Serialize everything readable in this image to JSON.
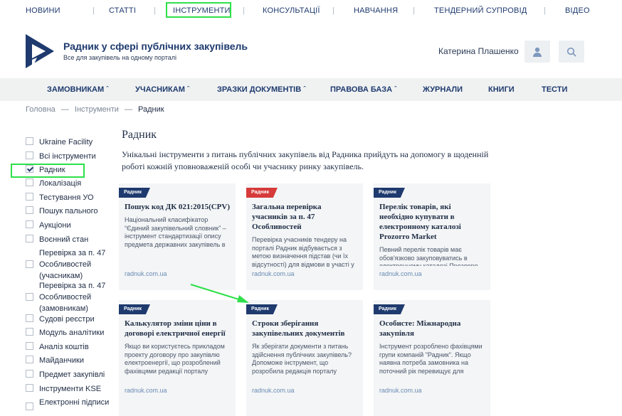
{
  "topnav": [
    "НОВИНИ",
    "СТАТТІ",
    "ІНСТРУМЕНТИ",
    "КОНСУЛЬТАЦІЇ",
    "НАВЧАННЯ",
    "ТЕНДЕРНИЙ СУПРОВІД",
    "ВІДЕО"
  ],
  "brand": {
    "title": "Радник у сфері публічних закупівель",
    "tagline": "Все для закупівель на одному порталі"
  },
  "user": {
    "name": "Катерина Плашенко"
  },
  "icons": {
    "user": "user-icon",
    "search": "search-icon",
    "chevron": "chevron-up-icon"
  },
  "mainnav": [
    "ЗАМОВНИКАМ",
    "УЧАСНИКАМ",
    "ЗРАЗКИ ДОКУМЕНТІВ",
    "ПРАВОВА БАЗА",
    "ЖУРНАЛИ",
    "КНИГИ",
    "ТЕСТИ"
  ],
  "breadcrumb": {
    "home": "Головна",
    "sep": "—",
    "parent": "Інструменти",
    "current": "Радник"
  },
  "filters": [
    {
      "label": "Ukraine Facility",
      "checked": false
    },
    {
      "label": "Всі інструменти",
      "checked": false
    },
    {
      "label": "Радник",
      "checked": true
    },
    {
      "label": "Локалізація",
      "checked": false
    },
    {
      "label": "Тестування УО",
      "checked": false
    },
    {
      "label": "Пошук пального",
      "checked": false
    },
    {
      "label": "Аукціони",
      "checked": false
    },
    {
      "label": "Воєнний стан",
      "checked": false
    },
    {
      "label": "Перевірка за п. 47 Особливостей (учасникам)",
      "checked": false
    },
    {
      "label": "Перевірка за п. 47 Особливостей (замовникам)",
      "checked": false
    },
    {
      "label": "Судові реєстри",
      "checked": false
    },
    {
      "label": "Модуль аналітики",
      "checked": false
    },
    {
      "label": "Аналіз коштів",
      "checked": false
    },
    {
      "label": "Майданчики",
      "checked": false
    },
    {
      "label": "Предмет закупівлі",
      "checked": false
    },
    {
      "label": "Інструменти KSE",
      "checked": false
    },
    {
      "label": "Електронні підписи",
      "checked": false
    }
  ],
  "page": {
    "title": "Радник",
    "intro": "Унікальні інструменти з питань публічних закупівель від Радника прийдуть на допомогу в щоденній роботі кожній уповноваженій особі чи учаснику ринку закупівель."
  },
  "colors": {
    "badge_blue": "#1e3a6e",
    "badge_red": "#d63a3a",
    "highlight": "#2ee04a"
  },
  "cards": [
    {
      "badge": "Радник",
      "badge_color": "#1e3a6e",
      "title": "Пошук код ДК 021:2015(CPV)",
      "desc": "Національний класифікатор “Єдиний закупівельний словник” – інструмент стандартизації опису предмета державних закупівель в",
      "url": "radnuk.com.ua"
    },
    {
      "badge": "Радник",
      "badge_color": "#d63a3a",
      "title": "Загальна перевірка учасників за п. 47 Особливостей",
      "desc": "Перевірка учасників тендеру на порталі Радник відбувається з метою визначення підстав (чи їх відсутності) для відмови в участі у",
      "url": "radnuk.com.ua"
    },
    {
      "badge": "Радник",
      "badge_color": "#1e3a6e",
      "title": "Перелік товарів, які необхідно купувати в електронному каталозі Prozorro Market",
      "desc": "Певний перелік товарів має обов'язково закуповуватись в електронному каталозі Прозорро",
      "url": "radnuk.com.ua"
    },
    {
      "badge": "Радник",
      "badge_color": "#1e3a6e",
      "title": "Калькулятор зміни ціни в договорі електричної енергії",
      "desc": "Якщо ви користуєтесь прикладом проекту договору про закупівлю електроенергії, що розроблений фахівцями редакції порталу",
      "url": "radnuk.com.ua"
    },
    {
      "badge": "Радник",
      "badge_color": "#1e3a6e",
      "title": "Строки зберігання закупівельних документів",
      "desc": "Як зберігати документи з питань здійснення публічних закупівель? Допоможе інструмент, що розробила редакція порталу",
      "url": "radnuk.com.ua"
    },
    {
      "badge": "Радник",
      "badge_color": "#1e3a6e",
      "title": "Особисте: Міжнародна закупівля",
      "desc": "Інструмент розроблено фахівцями групи компаній \"Радник\". Якщо наявна потреба замовника на поточний рік перевищує для",
      "url": "radnuk.com.ua"
    }
  ]
}
